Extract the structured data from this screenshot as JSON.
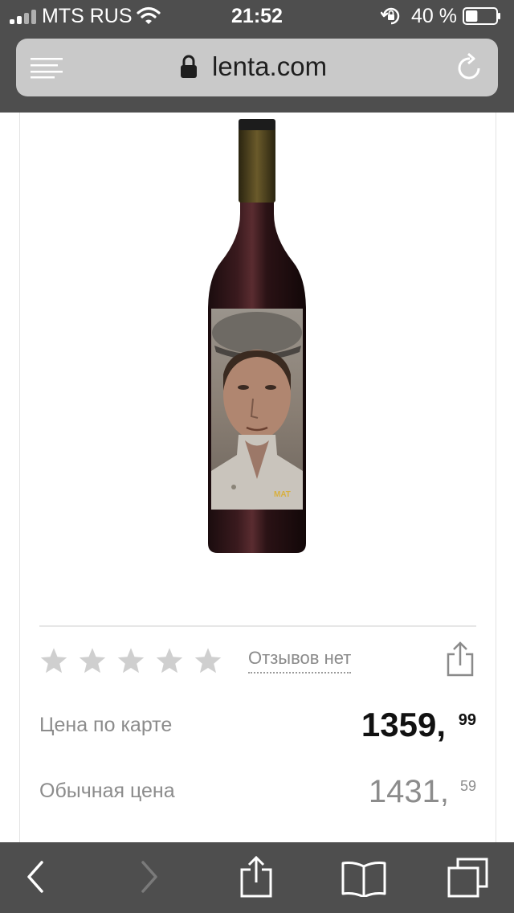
{
  "status_bar": {
    "carrier": "MTS RUS",
    "time": "21:52",
    "battery_percent": "40 %",
    "battery_level": 0.4
  },
  "address_bar": {
    "url": "lenta.com",
    "icons": [
      "menu-icon",
      "lock-icon",
      "reload-icon"
    ]
  },
  "product": {
    "rating": {
      "stars_filled": 0,
      "stars_total": 5,
      "reviews_label": "Отзывов нет"
    },
    "card_price": {
      "label": "Цена по карте",
      "main": "1359,",
      "cents": "99"
    },
    "regular_price": {
      "label": "Обычная цена",
      "main": "1431,",
      "cents": "59"
    }
  },
  "toolbar": {
    "icons": [
      "back-icon",
      "forward-icon",
      "share-icon",
      "bookmarks-icon",
      "tabs-icon"
    ]
  },
  "colors": {
    "chrome_bg": "#4e4e4e",
    "address_bg": "#c9c9c9",
    "star_gray": "#cfcfcf",
    "muted_text": "#8c8c8c"
  }
}
